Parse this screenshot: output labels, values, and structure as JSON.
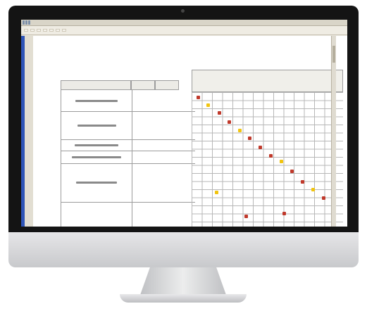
{
  "screen": {
    "window_title": "",
    "ribbon_tabs": [
      "",
      "",
      "",
      "",
      "",
      "",
      ""
    ],
    "chart_header": "",
    "accent_color": "#2f55b8",
    "mark_colors": {
      "red": "#c0392b",
      "yellow": "#f1c40f"
    }
  }
}
